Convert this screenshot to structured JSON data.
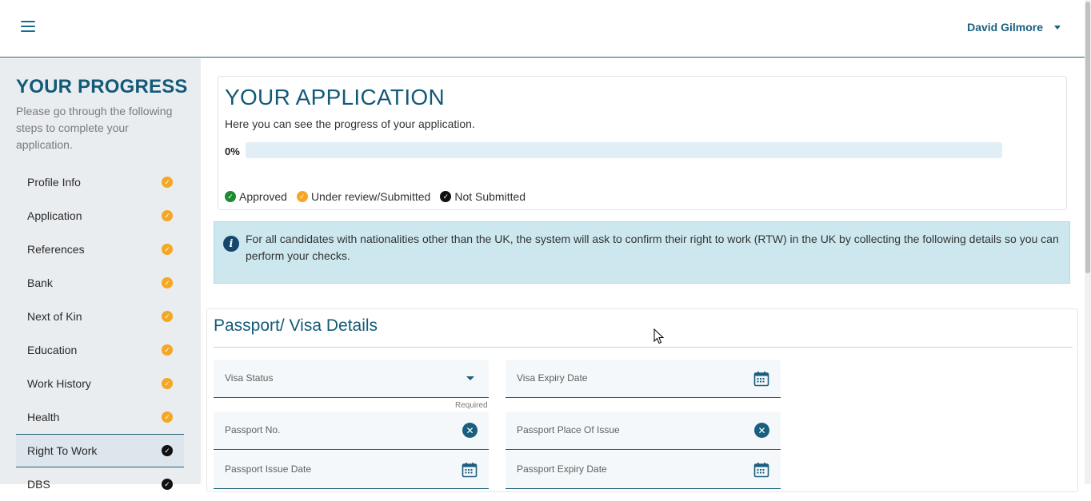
{
  "header": {
    "user_name": "David Gilmore"
  },
  "sidebar": {
    "title": "YOUR PROGRESS",
    "intro": "Please go through the following steps to complete your application.",
    "steps": [
      {
        "label": "Profile Info",
        "status": "orange"
      },
      {
        "label": "Application",
        "status": "orange"
      },
      {
        "label": "References",
        "status": "orange"
      },
      {
        "label": "Bank",
        "status": "orange"
      },
      {
        "label": "Next of Kin",
        "status": "orange"
      },
      {
        "label": "Education",
        "status": "orange"
      },
      {
        "label": "Work History",
        "status": "orange"
      },
      {
        "label": "Health",
        "status": "orange"
      },
      {
        "label": "Right To Work",
        "status": "black"
      },
      {
        "label": "DBS",
        "status": "black"
      }
    ],
    "active_step": "Right To Work"
  },
  "application": {
    "title": "YOUR APPLICATION",
    "subtitle": "Here you can see the progress of your application.",
    "progress_label": "0%",
    "progress_value": 0,
    "legend": [
      {
        "label": "Approved",
        "color": "#1e8a2f"
      },
      {
        "label": "Under review/Submitted",
        "color": "#f5a623"
      },
      {
        "label": "Not Submitted",
        "color": "#111111"
      }
    ]
  },
  "info": {
    "text": "For all candidates with nationalities other than the UK, the system will ask to confirm their right to work (RTW) in the UK by collecting the following details so you can perform your checks."
  },
  "passport": {
    "title": "Passport/ Visa Details",
    "fields": {
      "visa_status": "Visa Status",
      "visa_status_hint": "Required",
      "visa_expiry": "Visa Expiry Date",
      "passport_no": "Passport No.",
      "passport_place": "Passport Place Of Issue",
      "passport_issue": "Passport Issue Date",
      "passport_expiry": "Passport Expiry Date"
    }
  },
  "colors": {
    "brand": "#135a78",
    "approved": "#1e8a2f",
    "review": "#f5a623",
    "not_submitted": "#111111"
  }
}
